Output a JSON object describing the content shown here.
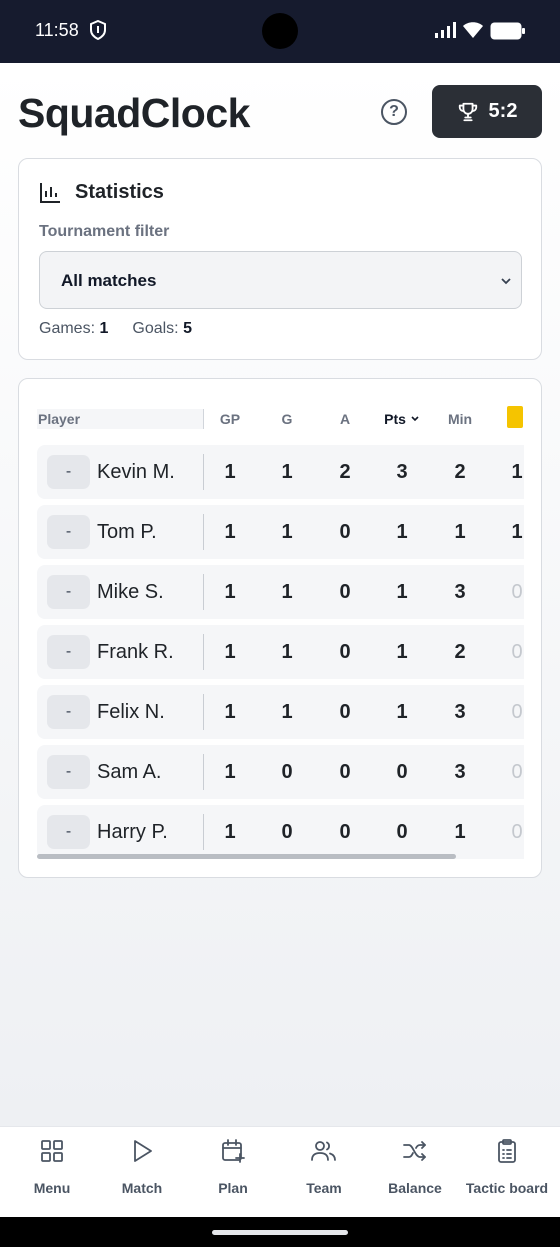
{
  "status_bar": {
    "time": "11:58"
  },
  "header": {
    "app_title": "SquadClock",
    "help_icon": "help-circle-icon",
    "score": "5:2",
    "score_icon": "trophy-icon"
  },
  "stats": {
    "title": "Statistics",
    "filter_label": "Tournament filter",
    "filter_value": "All matches",
    "games_label": "Games:",
    "games_value": "1",
    "goals_label": "Goals:",
    "goals_value": "5"
  },
  "table": {
    "columns": {
      "player": "Player",
      "gp": "GP",
      "g": "G",
      "a": "A",
      "pts": "Pts",
      "min": "Min"
    },
    "sorted_column": "Pts",
    "yellow_card_color": "#f5c400",
    "rows": [
      {
        "btn": "-",
        "name": "Kevin M.",
        "gp": "1",
        "g": "1",
        "a": "2",
        "pts": "3",
        "min": "2",
        "yc": "1"
      },
      {
        "btn": "-",
        "name": "Tom P.",
        "gp": "1",
        "g": "1",
        "a": "0",
        "pts": "1",
        "min": "1",
        "yc": "1"
      },
      {
        "btn": "-",
        "name": "Mike S.",
        "gp": "1",
        "g": "1",
        "a": "0",
        "pts": "1",
        "min": "3",
        "yc": "0"
      },
      {
        "btn": "-",
        "name": "Frank R.",
        "gp": "1",
        "g": "1",
        "a": "0",
        "pts": "1",
        "min": "2",
        "yc": "0"
      },
      {
        "btn": "-",
        "name": "Felix N.",
        "gp": "1",
        "g": "1",
        "a": "0",
        "pts": "1",
        "min": "3",
        "yc": "0"
      },
      {
        "btn": "-",
        "name": "Sam A.",
        "gp": "1",
        "g": "0",
        "a": "0",
        "pts": "0",
        "min": "3",
        "yc": "0"
      },
      {
        "btn": "-",
        "name": "Harry P.",
        "gp": "1",
        "g": "0",
        "a": "0",
        "pts": "0",
        "min": "1",
        "yc": "0"
      }
    ]
  },
  "nav": [
    {
      "label": "Menu",
      "icon": "grid-icon"
    },
    {
      "label": "Match",
      "icon": "play-icon"
    },
    {
      "label": "Plan",
      "icon": "calendar-plus-icon"
    },
    {
      "label": "Team",
      "icon": "users-icon"
    },
    {
      "label": "Balance",
      "icon": "shuffle-icon"
    },
    {
      "label": "Tactic board",
      "icon": "clipboard-icon"
    }
  ]
}
